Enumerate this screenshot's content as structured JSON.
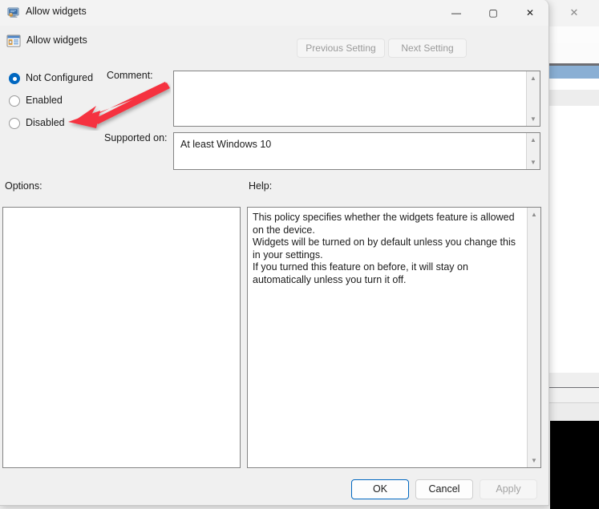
{
  "dialog": {
    "title": "Allow widgets",
    "title_icon": "group-policy-monitor-icon",
    "header_title": "Allow widgets",
    "header_icon": "policy-setting-window-icon",
    "window_controls": {
      "minimize": "—",
      "maximize": "▢",
      "close": "✕"
    },
    "navigation": {
      "previous_label": "Previous Setting",
      "next_label": "Next Setting",
      "previous_enabled": false,
      "next_enabled": false
    },
    "state_options": [
      {
        "label": "Not Configured",
        "selected": true
      },
      {
        "label": "Enabled",
        "selected": false
      },
      {
        "label": "Disabled",
        "selected": false
      }
    ],
    "comment": {
      "label": "Comment:",
      "value": "",
      "placeholder": ""
    },
    "supported_on": {
      "label": "Supported on:",
      "value": "At least Windows 10"
    },
    "options": {
      "label": "Options:",
      "value": ""
    },
    "help": {
      "label": "Help:",
      "text": "This policy specifies whether the widgets feature is allowed on the device.\nWidgets will be turned on by default unless you change this in your settings.\nIf you turned this feature on before, it will stay on automatically unless you turn it off."
    },
    "footer": {
      "ok_label": "OK",
      "cancel_label": "Cancel",
      "apply_label": "Apply",
      "apply_enabled": false
    },
    "scrollbar": {
      "up_glyph": "▲",
      "down_glyph": "▼"
    }
  },
  "background_window": {
    "close_glyph": "✕"
  },
  "annotation": {
    "type": "red-arrow",
    "color": "#f5333f",
    "points_to": "Disabled"
  }
}
